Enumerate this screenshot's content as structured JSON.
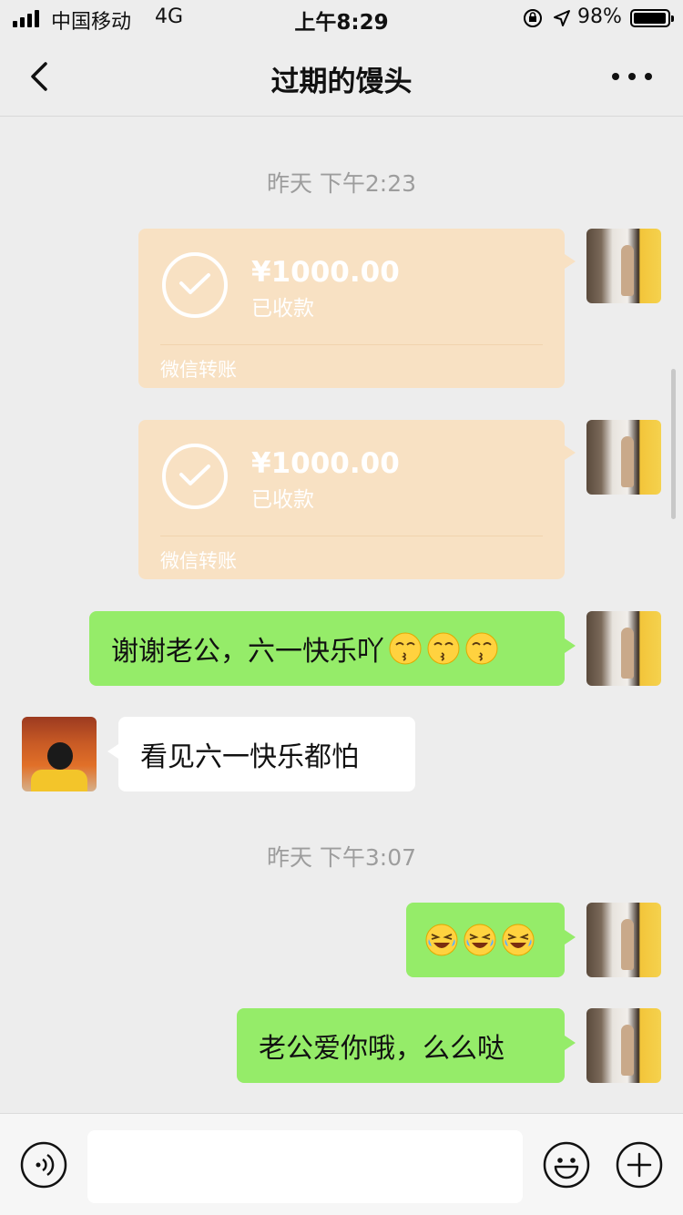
{
  "status_bar": {
    "carrier": "中国移动",
    "network": "4G",
    "time": "上午8:29",
    "battery_pct": "98%",
    "battery_level": 0.98
  },
  "nav": {
    "title": "过期的馒头"
  },
  "messages": {
    "time1": "昨天 下午2:23",
    "transfer1": {
      "amount": "¥1000.00",
      "status": "已收款",
      "source": "微信转账"
    },
    "transfer2": {
      "amount": "¥1000.00",
      "status": "已收款",
      "source": "微信转账"
    },
    "msg1": "谢谢老公，六一快乐吖",
    "msg2": "看见六一快乐都怕",
    "time2": "昨天 下午3:07",
    "msg4": "老公爱你哦，么么哒"
  },
  "emojis": {
    "kiss": "kissing-face-emoji",
    "laugh": "rolling-laughing-emoji"
  },
  "input": {
    "placeholder": ""
  }
}
